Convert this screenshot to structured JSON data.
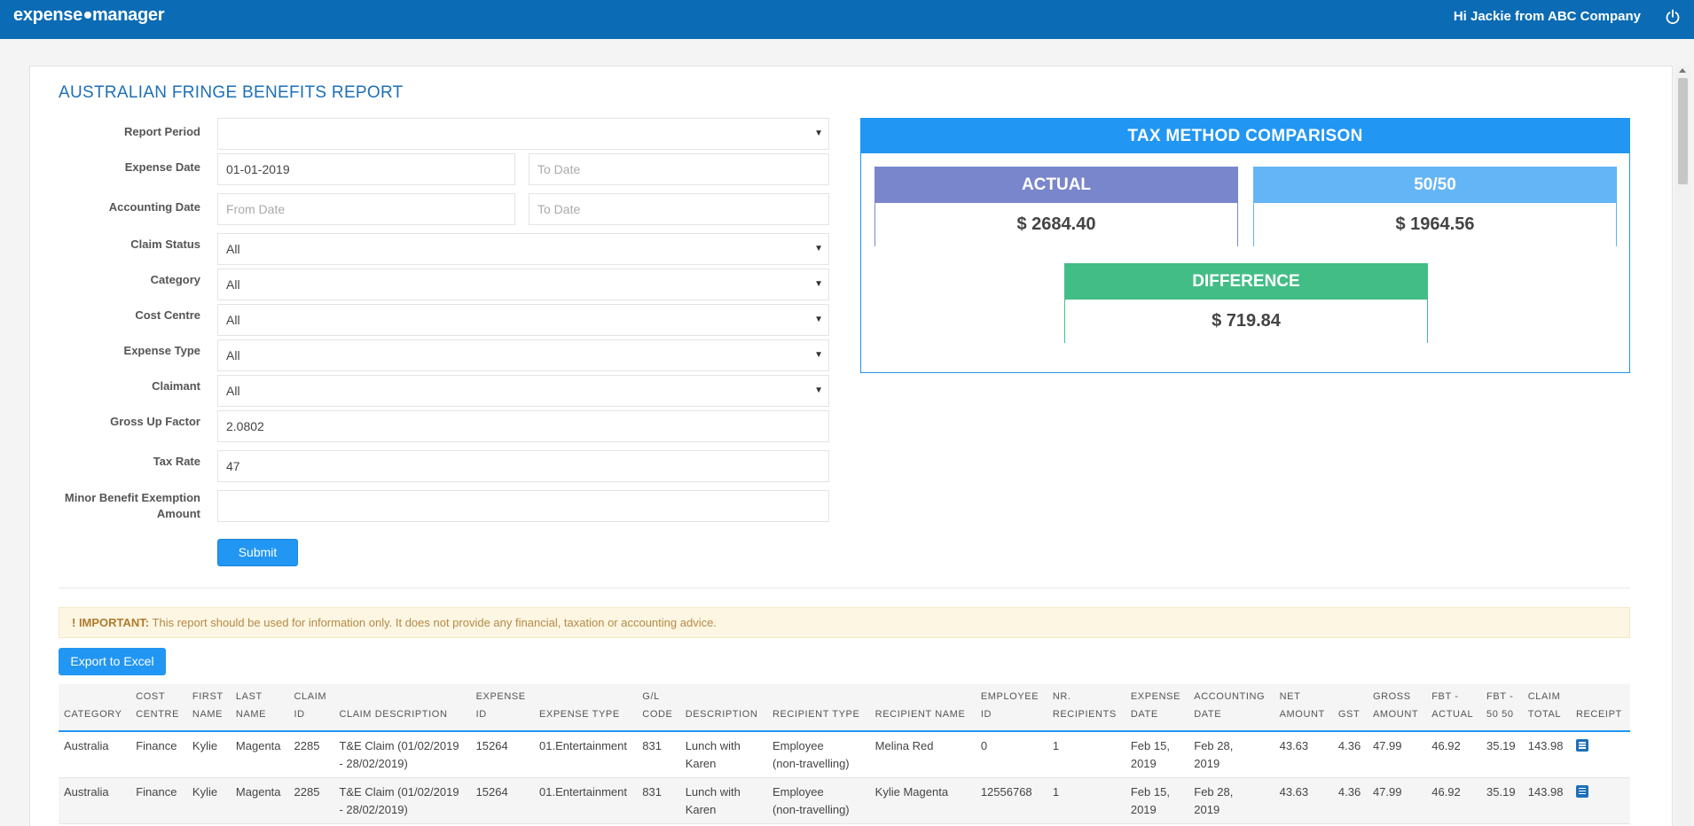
{
  "app": {
    "logo": "expense manager",
    "greeting": "Hi Jackie from ABC Company"
  },
  "page": {
    "title": "AUSTRALIAN FRINGE BENEFITS REPORT"
  },
  "form": {
    "report_period": {
      "label": "Report Period",
      "value": ""
    },
    "expense_date": {
      "label": "Expense Date",
      "from": "01-01-2019",
      "to_placeholder": "To Date"
    },
    "accounting_date": {
      "label": "Accounting Date",
      "from_placeholder": "From Date",
      "to_placeholder": "To Date"
    },
    "claim_status": {
      "label": "Claim Status",
      "value": "All"
    },
    "category": {
      "label": "Category",
      "value": "All"
    },
    "cost_centre": {
      "label": "Cost Centre",
      "value": "All"
    },
    "expense_type": {
      "label": "Expense Type",
      "value": "All"
    },
    "claimant": {
      "label": "Claimant",
      "value": "All"
    },
    "gross_up_factor": {
      "label": "Gross Up Factor",
      "value": "2.0802"
    },
    "tax_rate": {
      "label": "Tax Rate",
      "value": "47"
    },
    "minor_benefit": {
      "label_line1": "Minor Benefit Exemption",
      "label_line2": "Amount",
      "value": ""
    },
    "submit_label": "Submit"
  },
  "tax": {
    "title": "TAX METHOD COMPARISON",
    "actual": {
      "label": "ACTUAL",
      "value": "$ 2684.40"
    },
    "fifty": {
      "label": "50/50",
      "value": "$ 1964.56"
    },
    "difference": {
      "label": "DIFFERENCE",
      "value": "$ 719.84"
    }
  },
  "alert": {
    "strong": "! IMPORTANT:",
    "text": " This report should be used for information only. It does not provide any financial, taxation or accounting advice."
  },
  "export_label": "Export to Excel",
  "table": {
    "headers": [
      [
        "CATEGORY"
      ],
      [
        "COST",
        "CENTRE"
      ],
      [
        "FIRST",
        "NAME"
      ],
      [
        "LAST",
        "NAME"
      ],
      [
        "CLAIM",
        "ID"
      ],
      [
        "CLAIM DESCRIPTION"
      ],
      [
        "EXPENSE",
        "ID"
      ],
      [
        "EXPENSE TYPE"
      ],
      [
        "G/L",
        "CODE"
      ],
      [
        "DESCRIPTION"
      ],
      [
        "RECIPIENT TYPE"
      ],
      [
        "RECIPIENT NAME"
      ],
      [
        "EMPLOYEE",
        "ID"
      ],
      [
        "NR.",
        "RECIPIENTS"
      ],
      [
        "EXPENSE",
        "DATE"
      ],
      [
        "ACCOUNTING",
        "DATE"
      ],
      [
        "NET",
        "AMOUNT"
      ],
      [
        "GST"
      ],
      [
        "GROSS",
        "AMOUNT"
      ],
      [
        "FBT -",
        "ACTUAL"
      ],
      [
        "FBT -",
        "50 50"
      ],
      [
        "CLAIM",
        "TOTAL"
      ],
      [
        "RECEIPT"
      ]
    ],
    "rows": [
      {
        "category": "Australia",
        "cost_centre": "Finance",
        "first_name": "Kylie",
        "last_name": "Magenta",
        "claim_id": "2285",
        "claim_desc_1": "T&E Claim (01/02/2019",
        "claim_desc_2": "- 28/02/2019)",
        "expense_id": "15264",
        "expense_type": "01.Entertainment",
        "gl_code": "831",
        "desc_1": "Lunch with",
        "desc_2": "Karen",
        "recipient_type_1": "Employee",
        "recipient_type_2": "(non-travelling)",
        "recipient_name": "Melina Red",
        "employee_id": "0",
        "nr_recipients": "1",
        "expense_date_1": "Feb 15,",
        "expense_date_2": "2019",
        "accounting_date_1": "Feb 28,",
        "accounting_date_2": "2019",
        "net_amount": "43.63",
        "gst": "4.36",
        "gross_amount": "47.99",
        "fbt_actual": "46.92",
        "fbt_5050": "35.19",
        "claim_total": "143.98",
        "receipt_icon": "document-icon"
      },
      {
        "category": "Australia",
        "cost_centre": "Finance",
        "first_name": "Kylie",
        "last_name": "Magenta",
        "claim_id": "2285",
        "claim_desc_1": "T&E Claim (01/02/2019",
        "claim_desc_2": "- 28/02/2019)",
        "expense_id": "15264",
        "expense_type": "01.Entertainment",
        "gl_code": "831",
        "desc_1": "Lunch with",
        "desc_2": "Karen",
        "recipient_type_1": "Employee",
        "recipient_type_2": "(non-travelling)",
        "recipient_name": "Kylie Magenta",
        "employee_id": "12556768",
        "nr_recipients": "1",
        "expense_date_1": "Feb 15,",
        "expense_date_2": "2019",
        "accounting_date_1": "Feb 28,",
        "accounting_date_2": "2019",
        "net_amount": "43.63",
        "gst": "4.36",
        "gross_amount": "47.99",
        "fbt_actual": "46.92",
        "fbt_5050": "35.19",
        "claim_total": "143.98",
        "receipt_icon": "document-icon"
      }
    ]
  },
  "colors": {
    "topbar": "#0b6bb4",
    "primary": "#2196f3",
    "actual": "#7986cb",
    "fifty": "#64b5f6",
    "difference": "#43bd86"
  }
}
